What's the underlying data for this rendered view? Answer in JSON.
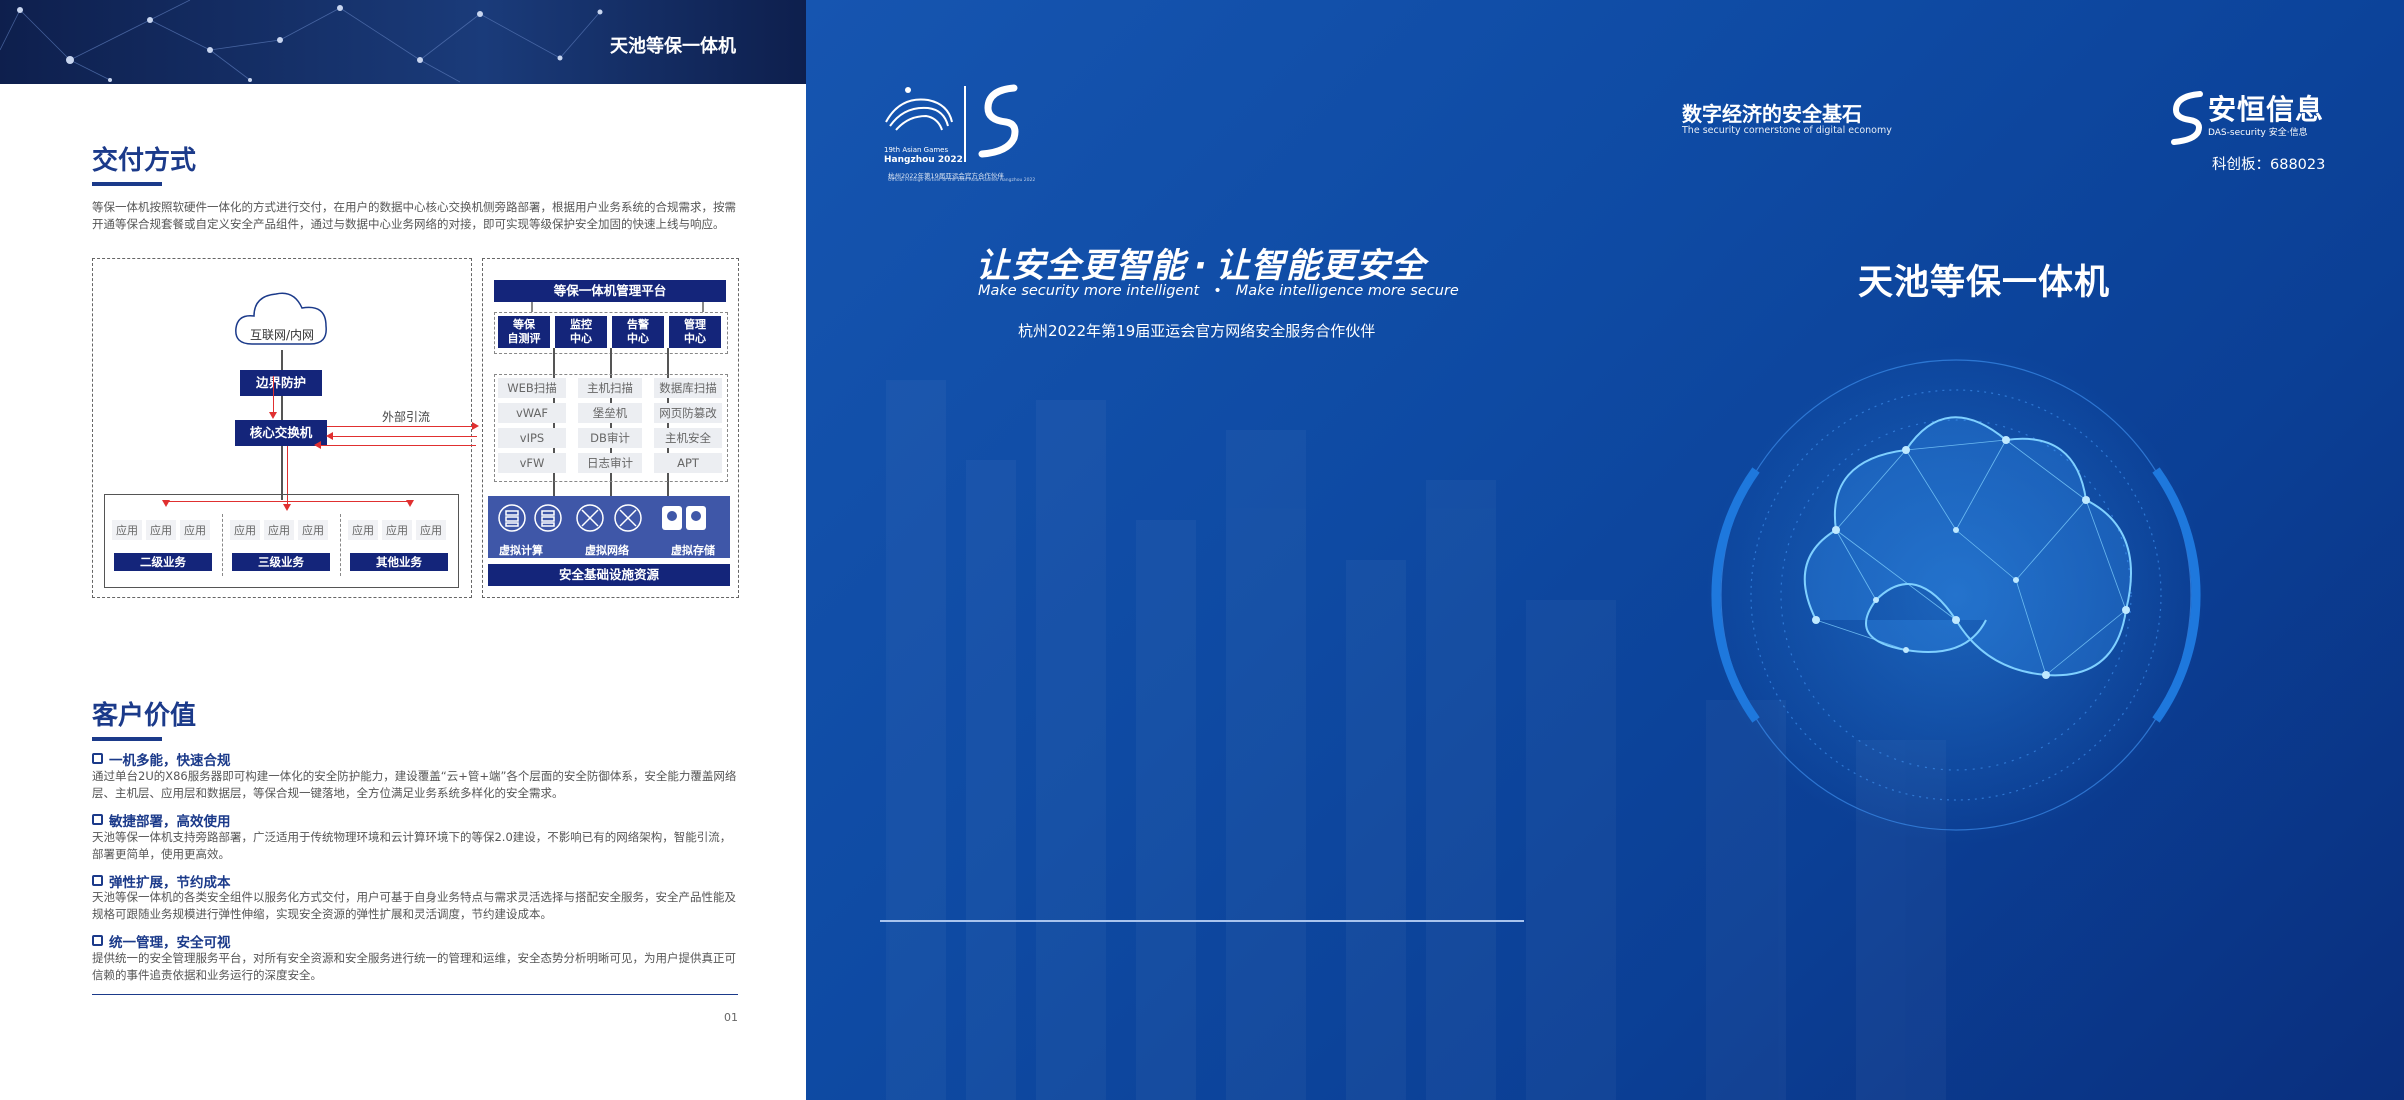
{
  "left": {
    "banner_title": "天池等保一体机",
    "delivery": {
      "title": "交付方式",
      "paragraph": "等保一体机按照软硬件一体化的方式进行交付，在用户的数据中心核心交换机侧旁路部署，根据用户业务系统的合规需求，按需开通等保合规套餐或自定义安全产品组件，通过与数据中心业务网络的对接，即可实现等级保护安全加固的快速上线与响应。"
    },
    "diagram": {
      "internet": "互联网/内网",
      "border": "边界防护",
      "core_switch": "核心交换机",
      "external_traffic": "外部引流",
      "app_label": "应用",
      "groups": [
        "二级业务",
        "三级业务",
        "其他业务"
      ],
      "platform": "等保一体机管理平台",
      "centers": [
        "等保\n自测评",
        "监控\n中心",
        "告警\n中心",
        "管理\n中心"
      ],
      "services": [
        [
          "WEB扫描",
          "主机扫描",
          "数据库扫描"
        ],
        [
          "vWAF",
          "堡垒机",
          "网页防篡改"
        ],
        [
          "vIPS",
          "DB审计",
          "主机安全"
        ],
        [
          "vFW",
          "日志审计",
          "APT"
        ]
      ],
      "virtual": [
        "虚拟计算",
        "虚拟网络",
        "虚拟存储"
      ],
      "infra": "安全基础设施资源"
    },
    "value": {
      "title": "客户价值",
      "items": [
        {
          "title": "一机多能，快速合规",
          "text": "通过单台2U的X86服务器即可构建一体化的安全防护能力，建设覆盖“云+管+端”各个层面的安全防御体系，安全能力覆盖网络层、主机层、应用层和数据层，等保合规一键落地，全方位满足业务系统多样化的安全需求。"
        },
        {
          "title": "敏捷部署，高效使用",
          "text": "天池等保一体机支持旁路部署，广泛适用于传统物理环境和云计算环境下的等保2.0建设，不影响已有的网络架构，智能引流，部署更简单，使用更高效。"
        },
        {
          "title": "弹性扩展，节约成本",
          "text": "天池等保一体机的各类安全组件以服务化方式交付，用户可基于自身业务特点与需求灵活选择与搭配安全服务，安全产品性能及规格可跟随业务规模进行弹性伸缩，实现安全资源的弹性扩展和灵活调度，节约建设成本。"
        },
        {
          "title": "统一管理，安全可视",
          "text": "提供统一的安全管理服务平台，对所有安全资源和安全服务进行统一的管理和运维，安全态势分析明晰可见，为用户提供真正可信赖的事件追责依据和业务运行的深度安全。"
        }
      ]
    },
    "page_number": "01"
  },
  "right": {
    "asian_games": {
      "line1": "19th Asian Games",
      "line2": "Hangzhou 2022",
      "caption": "杭州2022年第19届亚运会官方合作伙伴",
      "caption_en": "Official Prestige Partner of the 19th Asian Games Hangzhou 2022"
    },
    "tagline_cn": "数字经济的安全基石",
    "tagline_en": "The security cornerstone of digital economy",
    "brand": {
      "name_cn": "安恒信息",
      "name_en": "DAS-security",
      "name_en2": "安全·信息",
      "stock": "科创板：688023"
    },
    "slogan_cn_1": "让安全更智能",
    "slogan_dot": "·",
    "slogan_cn_2": "让智能更安全",
    "slogan_en_1": "Make security more intelligent",
    "slogan_en_2": "Make intelligence more secure",
    "partner_line": "杭州2022年第19届亚运会官方网络安全服务合作伙伴",
    "product_title": "天池等保一体机"
  },
  "colors": {
    "navy": "#14257a",
    "title_blue": "#1b3a8a",
    "cover_blue": "#0e4aa3",
    "alert_red": "#e03030"
  }
}
